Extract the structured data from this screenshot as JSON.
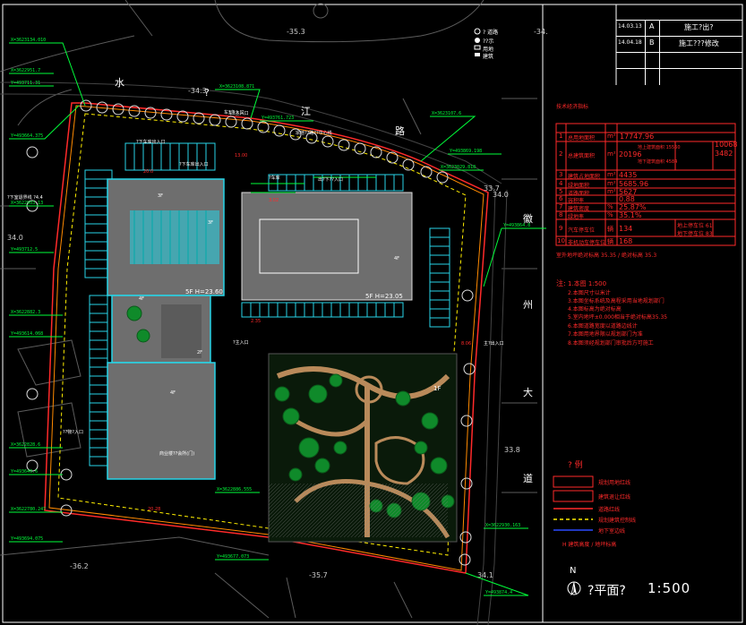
{
  "revisions": [
    {
      "date": "14.03.13",
      "letter": "A",
      "desc": "施工?出?"
    },
    {
      "date": "14.04.18",
      "letter": "B",
      "desc": "施工???修改"
    }
  ],
  "streets": {
    "north": [
      "水",
      "?",
      "江",
      "路"
    ],
    "east": [
      "徽",
      "州",
      "大",
      "道"
    ]
  },
  "elevations": [
    "35.3",
    "34.3",
    "34.0",
    "34.6",
    "33.7",
    "33.8",
    "34.1",
    "36.2",
    "35.7",
    "34.1"
  ],
  "legend_top": {
    "items": [
      "? 道路",
      "??示",
      "用地",
      "建筑"
    ]
  },
  "buildings": {
    "main_north": {
      "label": "5F H=23.05"
    },
    "west_block": {
      "label": "5F H=23.60"
    },
    "kiosk": {
      "label": "1F"
    }
  },
  "entrances": {
    "north": "车?主入口",
    "east": "主?出入口",
    "south": "?主入口"
  },
  "tech_table": {
    "title": "技术经济指标",
    "rows": [
      {
        "n": "1",
        "name": "总用地面积",
        "unit": "m²",
        "value": "17747.96"
      },
      {
        "n": "2",
        "name": "总建筑面积",
        "unit": "m²",
        "value": "20196",
        "sub": [
          "地上建筑面积 15560",
          "地下建筑面积 4584"
        ],
        "sub2": [
          "10068",
          "3482"
        ]
      },
      {
        "n": "3",
        "name": "建筑占地面积",
        "unit": "m²",
        "value": "4435"
      },
      {
        "n": "4",
        "name": "绿地面积",
        "unit": "m²",
        "value": "5685.96"
      },
      {
        "n": "5",
        "name": "道路面积",
        "unit": "m²",
        "value": "5627"
      },
      {
        "n": "6",
        "name": "容积率",
        "unit": "",
        "value": "0.88"
      },
      {
        "n": "7",
        "name": "建筑密度",
        "unit": "%",
        "value": "25.87%"
      },
      {
        "n": "8",
        "name": "绿地率",
        "unit": "%",
        "value": "35.1%"
      },
      {
        "n": "9",
        "name": "汽车停车位",
        "unit": "辆",
        "value": "134",
        "sub": [
          "地上停车位 61",
          "地下停车位 83"
        ]
      },
      {
        "n": "10",
        "name": "非机动车停车位",
        "unit": "辆",
        "value": "168"
      }
    ],
    "footnote": "室外地坪绝对标高 35.35 / 绝对标高 35.3"
  },
  "notes": {
    "title": "注:",
    "lines": [
      "1.本图 1:500",
      "2.本图尺寸以米计",
      "3.本图坐标系统及高程采用当地规划部门",
      "4.本图标高为绝对标高",
      "5.室内地坪±0.000相当于绝对标高35.35",
      "6.本图道路宽度以道路边线计",
      "7.本图用地界限以规划部门为准",
      "8.本图须经规划部门审批后方可施工"
    ]
  },
  "legend": {
    "title": "? 例",
    "items": [
      {
        "label": "规划用地红线",
        "style": "red-box"
      },
      {
        "label": "建筑退让红线",
        "style": "red-box"
      },
      {
        "label": "道路红线",
        "style": "red-line"
      },
      {
        "label": "规划建筑控制线",
        "style": "yellow-dash"
      },
      {
        "label": "地下室边线",
        "style": "blue-line"
      },
      {
        "label": "H 建筑高度 / 地坪标高",
        "style": "text"
      }
    ]
  },
  "drawing_title": "?平面?",
  "scale": "1:500",
  "north": "N",
  "colors": {
    "bg": "#000000",
    "red": "#ff2a2a",
    "green": "#00ff3a",
    "cyan": "#27d5e8",
    "yellow": "#ffee00",
    "gray": "#6e6e6e",
    "orange": "#ff8a00",
    "tan": "#b98a5a"
  }
}
